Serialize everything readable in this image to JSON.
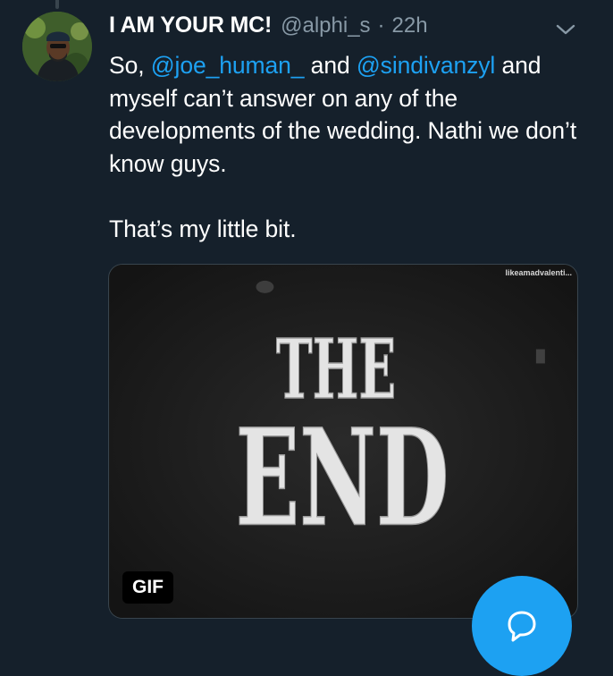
{
  "tweet": {
    "display_name": "I AM YOUR MC!",
    "handle": "@alphi_s",
    "separator": "·",
    "time": "22h",
    "body": {
      "line1_prefix": "So, ",
      "mention1": "@joe_human_",
      "line1_mid": " and ",
      "mention2": "@sindivanzyl",
      "line1_suffix": " and myself can’t answer on any of the developments of the wedding. Nathi we don’t know guys.",
      "paragraph2": "That’s my little bit."
    },
    "media": {
      "watermark": "likeamadvalenti...",
      "art_line1": "THE",
      "art_line2": "END",
      "badge": "GIF"
    }
  },
  "icons": {
    "caret": "chevron-down-icon",
    "compose": "reply-bubble-icon"
  },
  "colors": {
    "background": "#15202b",
    "accent": "#1da1f2",
    "secondary_text": "#8899a6"
  }
}
